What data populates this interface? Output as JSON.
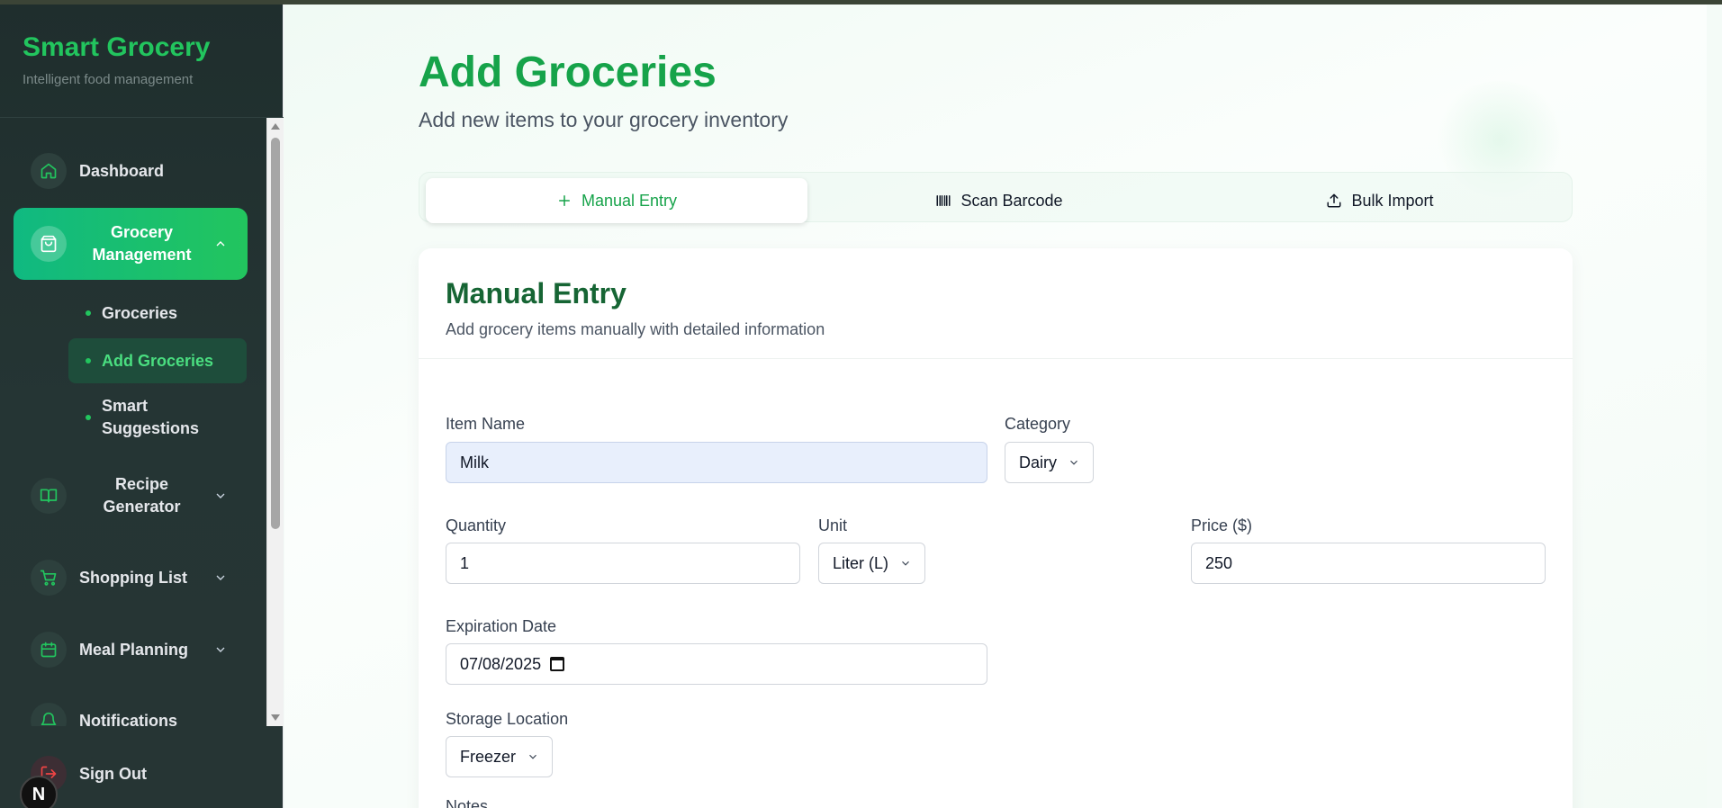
{
  "sidebar": {
    "brand_title": "Smart Grocery",
    "brand_subtitle": "Intelligent food management",
    "items": [
      {
        "label": "Dashboard",
        "icon": "home-icon"
      },
      {
        "label": "Grocery Management",
        "icon": "shopping-bag-icon",
        "expanded": true
      },
      {
        "label": "Recipe Generator",
        "icon": "book-open-icon"
      },
      {
        "label": "Shopping List",
        "icon": "shopping-cart-icon"
      },
      {
        "label": "Meal Planning",
        "icon": "calendar-icon"
      },
      {
        "label": "Notifications",
        "icon": "bell-icon"
      }
    ],
    "subitems": [
      {
        "label": "Groceries"
      },
      {
        "label": "Add Groceries",
        "active": true
      },
      {
        "label": "Smart Suggestions"
      }
    ],
    "signout_label": "Sign Out",
    "badge": "N"
  },
  "main": {
    "title": "Add Groceries",
    "subtitle": "Add new items to your grocery inventory",
    "tabs": [
      {
        "label": "Manual Entry",
        "icon": "plus-icon",
        "active": true
      },
      {
        "label": "Scan Barcode",
        "icon": "barcode-icon"
      },
      {
        "label": "Bulk Import",
        "icon": "upload-icon"
      }
    ]
  },
  "form": {
    "title": "Manual Entry",
    "subtitle": "Add grocery items manually with detailed information",
    "item_name": {
      "label": "Item Name",
      "value": "Milk"
    },
    "category": {
      "label": "Category",
      "value": "Dairy"
    },
    "quantity": {
      "label": "Quantity",
      "value": "1"
    },
    "unit": {
      "label": "Unit",
      "value": "Liter (L)"
    },
    "price": {
      "label": "Price ($)",
      "value": "250"
    },
    "expiration": {
      "label": "Expiration Date",
      "value": "07/08/2025"
    },
    "storage": {
      "label": "Storage Location",
      "value": "Freezer"
    },
    "notes_label": "Notes"
  },
  "colors": {
    "accent": "#22c55e",
    "accent_dark": "#16a34a",
    "sidebar_bg": "#1f2e2d",
    "signout": "#ef4444"
  }
}
